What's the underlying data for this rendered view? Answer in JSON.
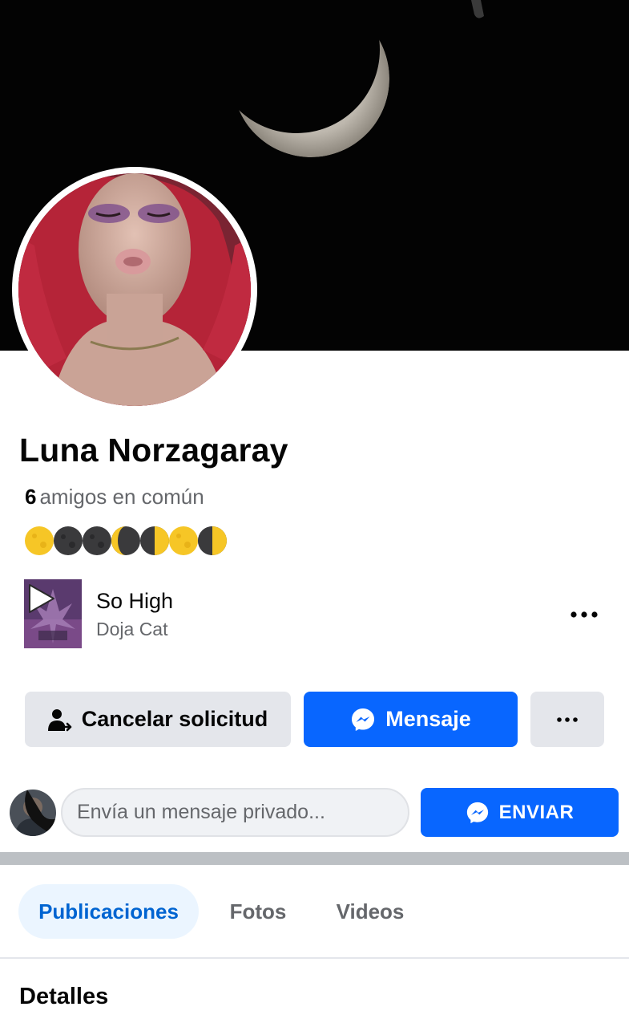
{
  "profile": {
    "name": "Luna Norzagaray",
    "mutual_count": "6",
    "mutual_label": "amigos en común",
    "status_emojis": [
      "full-moon",
      "new-moon",
      "new-moon",
      "new-moon",
      "first-quarter-moon",
      "full-moon",
      "last-quarter-moon"
    ]
  },
  "song": {
    "title": "So High",
    "artist": "Doja Cat",
    "play_icon": "play-icon",
    "more_icon": "more-horizontal-icon"
  },
  "actions": {
    "cancel_label": "Cancelar solicitud",
    "message_label": "Mensaje"
  },
  "composer": {
    "placeholder": "Envía un mensaje privado...",
    "send_label": "ENVIAR"
  },
  "tabs": [
    {
      "label": "Publicaciones",
      "active": true
    },
    {
      "label": "Fotos",
      "active": false
    },
    {
      "label": "Videos",
      "active": false
    }
  ],
  "section": {
    "title": "Detalles"
  },
  "colors": {
    "primary": "#0866ff",
    "secondary_button": "#e4e6eb",
    "tab_active_bg": "#ebf5ff",
    "tab_active_text": "#0064d1",
    "muted_text": "#65676b"
  }
}
